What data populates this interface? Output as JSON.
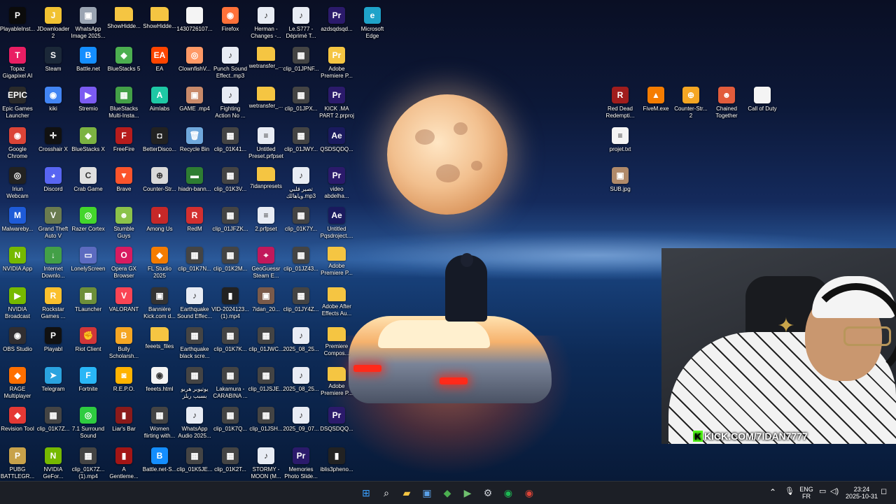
{
  "desktop": {
    "icons": [
      {
        "label": "PlayableInst...",
        "glyph": "P",
        "color": "#0b0b0b"
      },
      {
        "label": "JDownloader\n2",
        "glyph": "J",
        "color": "#f1c232"
      },
      {
        "label": "WhatsApp\nImage 2025...",
        "glyph": "▣",
        "color": "#9aa4b2"
      },
      {
        "label": "ShowHidde...",
        "glyph": "",
        "color": "#f5c542"
      },
      {
        "label": "ShowHidde...",
        "glyph": "",
        "color": "#f5c542"
      },
      {
        "label": "1430726107...",
        "glyph": "",
        "color": "#f4f4f4"
      },
      {
        "label": "Firefox",
        "glyph": "◉",
        "color": "#ff7139"
      },
      {
        "label": "Herman -\nChanges -...",
        "glyph": "♪",
        "color": "#e8ecf4"
      },
      {
        "label": "Le.S777 -\nDéprimé T...",
        "glyph": "♪",
        "color": "#e8ecf4"
      },
      {
        "label": "azdsqdsqd...",
        "glyph": "Pr",
        "color": "#2b1a6b"
      },
      {
        "label": "Microsoft\nEdge",
        "glyph": "e",
        "color": "#1fa3c9"
      },
      {
        "label": "Topaz\nGigapixel AI",
        "glyph": "T",
        "color": "#e91e63"
      },
      {
        "label": "Steam",
        "glyph": "S",
        "color": "#1b2838"
      },
      {
        "label": "Battle.net",
        "glyph": "B",
        "color": "#148eff"
      },
      {
        "label": "BlueStacks 5",
        "glyph": "◆",
        "color": "#4caf50"
      },
      {
        "label": "EA",
        "glyph": "EA",
        "color": "#ff4500"
      },
      {
        "label": "ClownfishV...",
        "glyph": "◎",
        "color": "#ff9966"
      },
      {
        "label": "Punch Sound\nEffect..mp3",
        "glyph": "♪",
        "color": "#e8ecf4"
      },
      {
        "label": "wetransfer_...",
        "glyph": "",
        "color": "#f5c542"
      },
      {
        "label": "clip_01JPNF...",
        "glyph": "▦",
        "color": "#444"
      },
      {
        "label": "Adobe\nPremiere P...",
        "glyph": "Pr",
        "color": "#f5c542"
      },
      {
        "label": "Epic Games\nLauncher",
        "glyph": "EPIC",
        "color": "#2a2a2a"
      },
      {
        "label": "kiki",
        "glyph": "◉",
        "color": "#4285f4"
      },
      {
        "label": "Stremio",
        "glyph": "▶",
        "color": "#7b5bf2"
      },
      {
        "label": "BlueStacks\nMulti-Insta...",
        "glyph": "▦",
        "color": "#43a047"
      },
      {
        "label": "Aimlabs",
        "glyph": "A",
        "color": "#1ec8a5"
      },
      {
        "label": "GAME .mp4",
        "glyph": "▣",
        "color": "#c98a6a"
      },
      {
        "label": "Fighting\nAction No ...",
        "glyph": "♪",
        "color": "#e8ecf4"
      },
      {
        "label": "wetransfer_...",
        "glyph": "",
        "color": "#f5c542"
      },
      {
        "label": "clip_01JPX...",
        "glyph": "▦",
        "color": "#444"
      },
      {
        "label": "KICK .MA\nPART 2.prproj",
        "glyph": "Pr",
        "color": "#2b1a6b"
      },
      {
        "label": "Google\nChrome",
        "glyph": "◉",
        "color": "#db4437"
      },
      {
        "label": "Crosshair X",
        "glyph": "✛",
        "color": "#111"
      },
      {
        "label": "BlueStacks X",
        "glyph": "◆",
        "color": "#7cb342"
      },
      {
        "label": "FreeFire",
        "glyph": "F",
        "color": "#b71c1c"
      },
      {
        "label": "BetterDisco...",
        "glyph": "◘",
        "color": "#222"
      },
      {
        "label": "Recycle Bin",
        "glyph": "🗑",
        "color": "#6fa8dc"
      },
      {
        "label": "clip_01K41...",
        "glyph": "▦",
        "color": "#444"
      },
      {
        "label": "Untitled\nPreset.prfpset",
        "glyph": "≡",
        "color": "#e8ecf4"
      },
      {
        "label": "clip_01JWY...",
        "glyph": "▦",
        "color": "#444"
      },
      {
        "label": "QSDSQDQ...",
        "glyph": "Ae",
        "color": "#1a1a5e"
      },
      {
        "label": "Iriun\nWebcam",
        "glyph": "◎",
        "color": "#222"
      },
      {
        "label": "Discord",
        "glyph": "◕",
        "color": "#5865f2"
      },
      {
        "label": "Crab Game",
        "glyph": "C",
        "color": "#e0e0e0"
      },
      {
        "label": "Brave",
        "glyph": "▼",
        "color": "#fb542b"
      },
      {
        "label": "Counter-Str...",
        "glyph": "⊕",
        "color": "#d9d9d9"
      },
      {
        "label": "hiadn-bann...",
        "glyph": "▬",
        "color": "#2e7d32"
      },
      {
        "label": "clip_01K3V...",
        "glyph": "▦",
        "color": "#444"
      },
      {
        "label": "7idanpresets",
        "glyph": "",
        "color": "#f5c542"
      },
      {
        "label": "تصير قلبي\nوياهالك.mp3",
        "glyph": "♪",
        "color": "#e8ecf4"
      },
      {
        "label": "video\nabdelha...",
        "glyph": "Pr",
        "color": "#2b1a6b"
      },
      {
        "label": "Malwareby...",
        "glyph": "M",
        "color": "#1e5bd8"
      },
      {
        "label": "Grand Theft\nAuto V",
        "glyph": "V",
        "color": "#6a7b4f"
      },
      {
        "label": "Razer Cortex",
        "glyph": "◎",
        "color": "#44d62c"
      },
      {
        "label": "Stumble\nGuys",
        "glyph": "☻",
        "color": "#8bc34a"
      },
      {
        "label": "Among Us",
        "glyph": "◗",
        "color": "#c62828"
      },
      {
        "label": "RedM",
        "glyph": "R",
        "color": "#d32f2f"
      },
      {
        "label": "clip_01JFZK...",
        "glyph": "▦",
        "color": "#444"
      },
      {
        "label": "2.prfpset",
        "glyph": "≡",
        "color": "#e8ecf4"
      },
      {
        "label": "clip_01K7Y...",
        "glyph": "▦",
        "color": "#444"
      },
      {
        "label": "Untitled\nPqsdroject....",
        "glyph": "Ae",
        "color": "#1a1a5e"
      },
      {
        "label": "NVIDIA App",
        "glyph": "N",
        "color": "#76b900"
      },
      {
        "label": "Internet\nDownlo...",
        "glyph": "↓",
        "color": "#43a047"
      },
      {
        "label": "LonelyScreen",
        "glyph": "▭",
        "color": "#5c6bc0"
      },
      {
        "label": "Opera GX\nBrowser",
        "glyph": "O",
        "color": "#d81b60"
      },
      {
        "label": "FL Studio\n2025",
        "glyph": "◆",
        "color": "#f57c00"
      },
      {
        "label": "clip_01K7N...",
        "glyph": "▦",
        "color": "#444"
      },
      {
        "label": "clip_01K2M...",
        "glyph": "▦",
        "color": "#444"
      },
      {
        "label": "GeoGuessr\nSteam E...",
        "glyph": "⌖",
        "color": "#c2185b"
      },
      {
        "label": "clip_01JZ43...",
        "glyph": "▦",
        "color": "#444"
      },
      {
        "label": "Adobe\nPremiere P...",
        "glyph": "",
        "color": "#f5c542"
      },
      {
        "label": "NVIDIA\nBroadcast",
        "glyph": "▶",
        "color": "#76b900"
      },
      {
        "label": "Rockstar\nGames ...",
        "glyph": "R",
        "color": "#fbc02d"
      },
      {
        "label": "TLauncher",
        "glyph": "▩",
        "color": "#6d8f3a"
      },
      {
        "label": "VALORANT",
        "glyph": "V",
        "color": "#fa4454"
      },
      {
        "label": "Bannière\nKick.com d...",
        "glyph": "▣",
        "color": "#333"
      },
      {
        "label": "Earthquake\nSound Effec...",
        "glyph": "♪",
        "color": "#e8ecf4"
      },
      {
        "label": "VID-2024123...\n(1).mp4",
        "glyph": "▮",
        "color": "#222"
      },
      {
        "label": "7idan_20...",
        "glyph": "▣",
        "color": "#7a5a4a"
      },
      {
        "label": "clip_01JY4Z...",
        "glyph": "▦",
        "color": "#444"
      },
      {
        "label": "Adobe After\nEffects Au...",
        "glyph": "",
        "color": "#f5c542"
      },
      {
        "label": "OBS Studio",
        "glyph": "◉",
        "color": "#302e31"
      },
      {
        "label": "Playabl",
        "glyph": "P",
        "color": "#111"
      },
      {
        "label": "Riot Client",
        "glyph": "✊",
        "color": "#d13639"
      },
      {
        "label": "Bully\nScholarsh...",
        "glyph": "B",
        "color": "#f5a623"
      },
      {
        "label": "feeets_files",
        "glyph": "",
        "color": "#f5c542"
      },
      {
        "label": "Earthquake\nblack scre...",
        "glyph": "▦",
        "color": "#444"
      },
      {
        "label": "clip_01K7K...",
        "glyph": "▦",
        "color": "#444"
      },
      {
        "label": "clip_01JWC...",
        "glyph": "▦",
        "color": "#444"
      },
      {
        "label": "2025_08_25...",
        "glyph": "♪",
        "color": "#e8ecf4"
      },
      {
        "label": "Premiere\nCompos...",
        "glyph": "",
        "color": "#f5c542"
      },
      {
        "label": "RAGE\nMultiplayer",
        "glyph": "◆",
        "color": "#ff6f00"
      },
      {
        "label": "Telegram",
        "glyph": "➤",
        "color": "#2aa3df"
      },
      {
        "label": "Fortnite",
        "glyph": "F",
        "color": "#29b6f6"
      },
      {
        "label": "R.E.P.O.",
        "glyph": "◙",
        "color": "#ffb300"
      },
      {
        "label": "feeets.html",
        "glyph": "◉",
        "color": "#f4f4f4"
      },
      {
        "label": "يوتيوبر هربو\nبسبب ربلز",
        "glyph": "▦",
        "color": "#444"
      },
      {
        "label": "Lakamura -\nCARABINA ...",
        "glyph": "▦",
        "color": "#444"
      },
      {
        "label": "clip_01JSJE...",
        "glyph": "▦",
        "color": "#444"
      },
      {
        "label": "2025_08_25...",
        "glyph": "♪",
        "color": "#e8ecf4"
      },
      {
        "label": "Adobe\nPremiere P...",
        "glyph": "",
        "color": "#f5c542"
      },
      {
        "label": "Revision Tool",
        "glyph": "◆",
        "color": "#e53935"
      },
      {
        "label": "clip_01K7Z...",
        "glyph": "▦",
        "color": "#444"
      },
      {
        "label": "7.1 Surround\nSound",
        "glyph": "◎",
        "color": "#2ecc40"
      },
      {
        "label": "Liar's Bar",
        "glyph": "▮",
        "color": "#8b1a1a"
      },
      {
        "label": "Women\nflirting with...",
        "glyph": "▦",
        "color": "#444"
      },
      {
        "label": "WhatsApp\nAudio 2025...",
        "glyph": "♪",
        "color": "#e8ecf4"
      },
      {
        "label": "clip_01K7Q...",
        "glyph": "▦",
        "color": "#444"
      },
      {
        "label": "clip_01JSH...",
        "glyph": "▦",
        "color": "#444"
      },
      {
        "label": "2025_09_07...",
        "glyph": "♪",
        "color": "#e8ecf4"
      },
      {
        "label": "DSQSDQQ...",
        "glyph": "Pr",
        "color": "#2b1a6b"
      },
      {
        "label": "PUBG\nBATTLEGR...",
        "glyph": "P",
        "color": "#c8a24a"
      },
      {
        "label": "NVIDIA\nGeFor...",
        "glyph": "N",
        "color": "#76b900"
      },
      {
        "label": "clip_01K7Z...\n(1).mp4",
        "glyph": "▦",
        "color": "#444"
      },
      {
        "label": "A\nGentleme...",
        "glyph": "▮",
        "color": "#a31515"
      },
      {
        "label": "Battle.net-S...",
        "glyph": "B",
        "color": "#148eff"
      },
      {
        "label": "clip_01K5JE...",
        "glyph": "▦",
        "color": "#444"
      },
      {
        "label": "clip_01K2T...",
        "glyph": "▦",
        "color": "#444"
      },
      {
        "label": "STORMY -\nMOON (M...",
        "glyph": "♪",
        "color": "#e8ecf4"
      },
      {
        "label": "Memories\nPhoto Slide...",
        "glyph": "Pr",
        "color": "#2b1a6b"
      },
      {
        "label": "iblis3pheno...",
        "glyph": "▮",
        "color": "#222"
      },
      {
        "label": "Red Dead\nRedempti...",
        "glyph": "R",
        "color": "#a01d1d"
      },
      {
        "label": "FiveM.exe",
        "glyph": "▲",
        "color": "#f57c00"
      },
      {
        "label": "Counter-Str...\n2",
        "glyph": "⊕",
        "color": "#f5a623"
      },
      {
        "label": "Chained\nTogether",
        "glyph": "☻",
        "color": "#e25c3c"
      },
      {
        "label": "Call of Duty",
        "glyph": "",
        "color": "#f4f4f4"
      },
      {
        "label": "projet.txt",
        "glyph": "≡",
        "color": "#f4f4f4"
      },
      {
        "label": "SUB.jpg",
        "glyph": "▣",
        "color": "#b08a6a"
      }
    ]
  },
  "webcam": {
    "overlay_prefix": "K",
    "overlay_text": "KICK.COM/7IDAN7777"
  },
  "taskbar": {
    "apps": [
      {
        "name": "start-button",
        "glyph": "⊞",
        "color": "#3aa0ff"
      },
      {
        "name": "search-button",
        "glyph": "⌕",
        "color": "#ffffff"
      },
      {
        "name": "file-explorer-button",
        "glyph": "▰",
        "color": "#f5c542"
      },
      {
        "name": "store-button",
        "glyph": "▣",
        "color": "#5aa0e8"
      },
      {
        "name": "bluestacks-button",
        "glyph": "◆",
        "color": "#4caf50"
      },
      {
        "name": "media-button",
        "glyph": "▶",
        "color": "#6ec06e"
      },
      {
        "name": "settings-button",
        "glyph": "⚙",
        "color": "#cfd3da"
      },
      {
        "name": "spotify-button",
        "glyph": "◉",
        "color": "#1db954"
      },
      {
        "name": "chrome-button",
        "glyph": "◉",
        "color": "#db4437"
      }
    ],
    "tray": {
      "chevron": "⌃",
      "mic": "🎙",
      "lang_top": "ENG",
      "lang_bottom": "FR",
      "time": "23:24",
      "date": "2025-10-31"
    }
  }
}
